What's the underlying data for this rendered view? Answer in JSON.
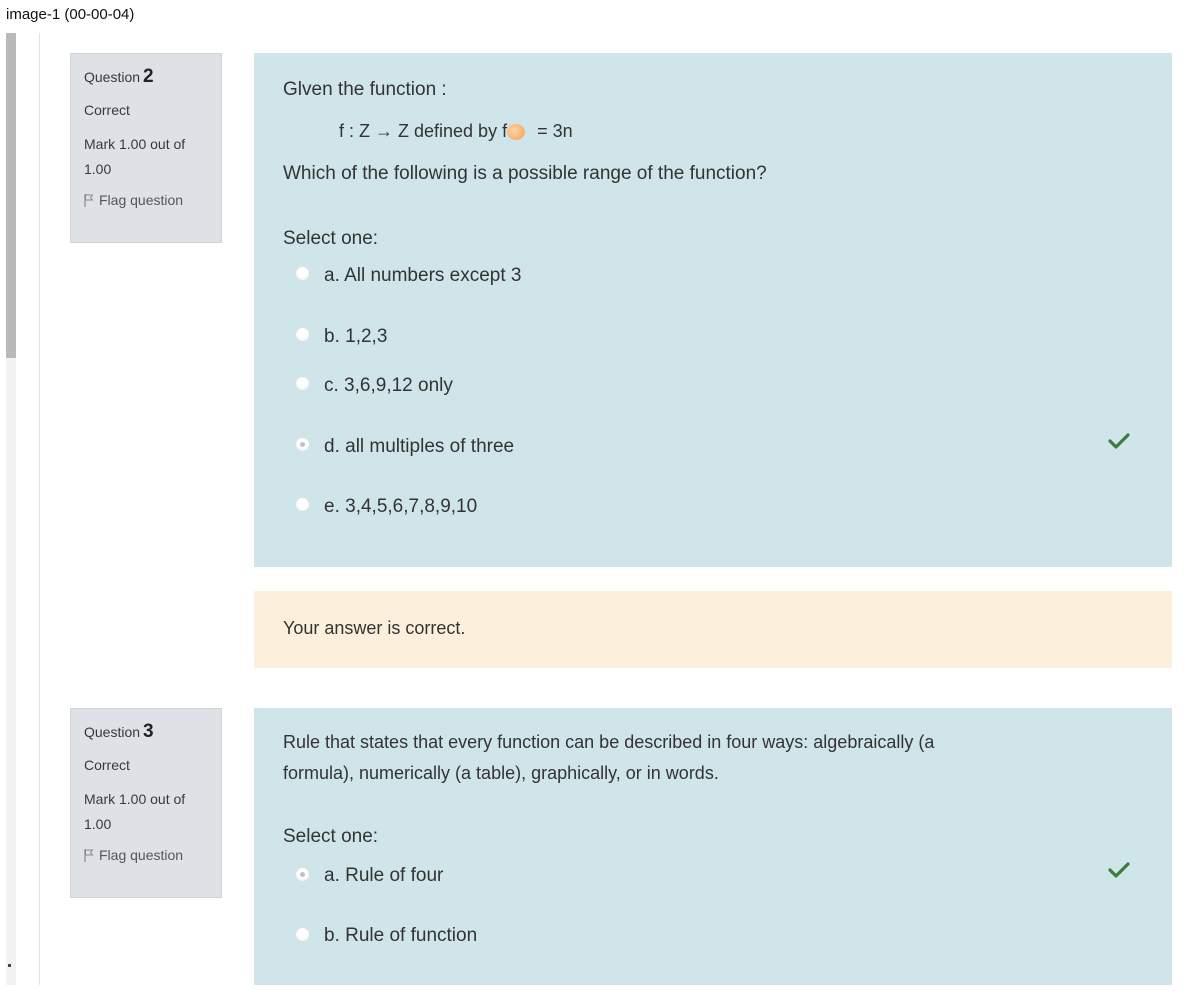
{
  "window": {
    "title": "image-1 (00-00-04)"
  },
  "questions": [
    {
      "label": "Question",
      "number": "2",
      "state": "Correct",
      "grade": "Mark 1.00 out of 1.00",
      "flag_label": "Flag question",
      "intro": "Glven the function :",
      "formula_left": "f : Z → Z defined by f",
      "formula_right": "= 3n",
      "prompt": "Which of the following is a  possible range of the function?",
      "select_label": "Select one:",
      "options": [
        {
          "text": "a. All numbers except 3",
          "selected": false,
          "correct": false
        },
        {
          "text": "b. 1,2,3",
          "selected": false,
          "correct": false
        },
        {
          "text": "c. 3,6,9,12 only",
          "selected": false,
          "correct": false
        },
        {
          "text": "d. all multiples of three",
          "selected": true,
          "correct": true
        },
        {
          "text": "e. 3,4,5,6,7,8,9,10",
          "selected": false,
          "correct": false
        }
      ],
      "feedback": "Your answer is correct."
    },
    {
      "label": "Question",
      "number": "3",
      "state": "Correct",
      "grade": "Mark 1.00 out of 1.00",
      "flag_label": "Flag question",
      "prompt_line1": "Rule that states that every function can be described in four ways: algebraically (a",
      "prompt_line2": "formula), numerically (a table), graphically, or in words.",
      "select_label": "Select one:",
      "options": [
        {
          "text": "a. Rule of four",
          "selected": true,
          "correct": true
        },
        {
          "text": "b. Rule of function",
          "selected": false,
          "correct": false
        }
      ]
    }
  ],
  "colors": {
    "question_bg": "#cfe5ea",
    "info_bg": "#dee2e6",
    "feedback_bg": "#fcefdc",
    "correct_check": "#3b7d3b"
  },
  "icons": {
    "flag": "flag-icon",
    "correct": "check-icon"
  }
}
